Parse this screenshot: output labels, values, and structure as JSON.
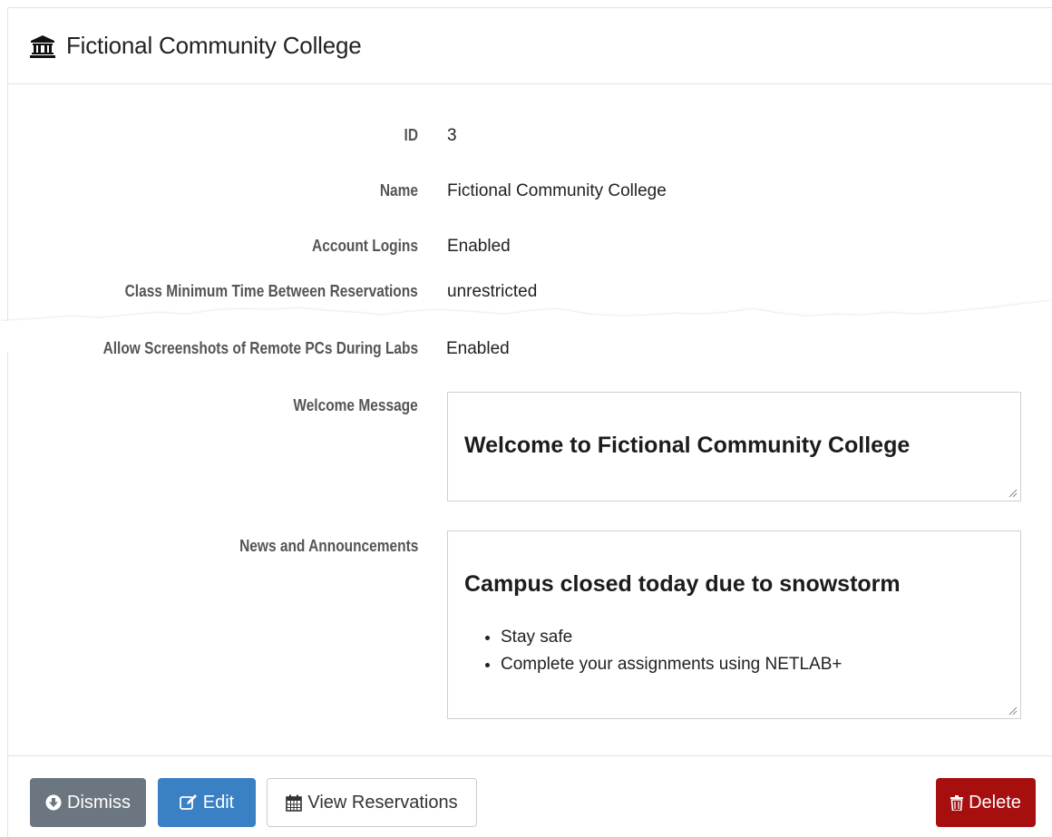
{
  "header": {
    "title": "Fictional Community College",
    "icon": "bank-icon"
  },
  "fields": [
    {
      "label": "ID",
      "value": "3"
    },
    {
      "label": "Name",
      "value": "Fictional Community College"
    },
    {
      "label": "Account Logins",
      "value": "Enabled"
    },
    {
      "label": "Class Minimum Time Between Reservations",
      "value": "unrestricted"
    },
    {
      "label": "Allow Screenshots of Remote PCs During Labs",
      "value": "Enabled"
    }
  ],
  "welcome": {
    "label": "Welcome Message",
    "heading": "Welcome to Fictional Community College"
  },
  "news": {
    "label": "News and Announcements",
    "heading": "Campus closed today due to snowstorm",
    "items": [
      "Stay safe",
      "Complete your assignments using NETLAB+"
    ]
  },
  "buttons": {
    "dismiss": "Dismiss",
    "edit": "Edit",
    "view_reservations": "View Reservations",
    "delete": "Delete"
  },
  "colors": {
    "dismiss": "#6c7680",
    "edit": "#3a80c4",
    "delete": "#a70f0f"
  }
}
